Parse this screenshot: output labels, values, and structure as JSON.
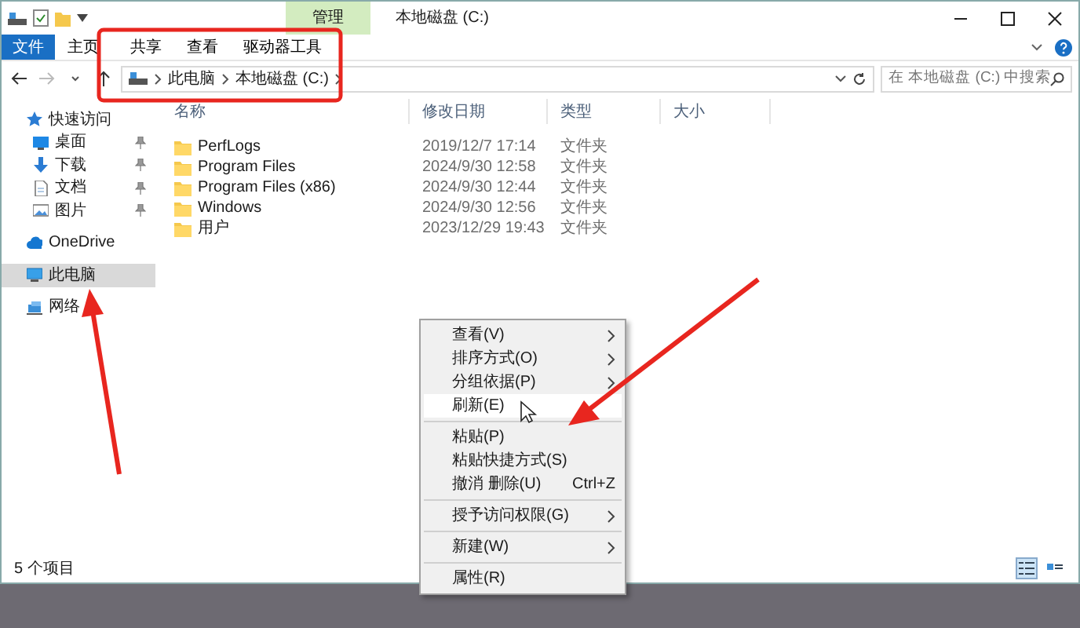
{
  "title_bar": {
    "context_tab": "管理",
    "title": "本地磁盘 (C:)"
  },
  "ribbon_tabs": [
    {
      "label": "文件",
      "kind": "file",
      "selected": false
    },
    {
      "label": "主页",
      "kind": "tab",
      "selected": false
    },
    {
      "label": "共享",
      "kind": "tab",
      "selected": false
    },
    {
      "label": "查看",
      "kind": "tab",
      "selected": false
    },
    {
      "label": "驱动器工具",
      "kind": "tab",
      "selected": false
    }
  ],
  "address_bar": {
    "path": [
      "此电脑",
      "本地磁盘 (C:)"
    ]
  },
  "search": {
    "placeholder": "在 本地磁盘 (C:) 中搜索"
  },
  "sidebar": {
    "items": [
      {
        "label": "快速访问",
        "kind": "star",
        "selected": false,
        "children": [
          {
            "label": "桌面",
            "kind": "desktop",
            "pinned": true,
            "selected": false
          },
          {
            "label": "下载",
            "kind": "download",
            "pinned": true,
            "selected": false
          },
          {
            "label": "文档",
            "kind": "document",
            "pinned": true,
            "selected": false
          },
          {
            "label": "图片",
            "kind": "picture",
            "pinned": true,
            "selected": false
          }
        ]
      },
      {
        "label": "OneDrive",
        "kind": "cloud",
        "selected": false
      },
      {
        "label": "此电脑",
        "kind": "computer",
        "selected": true
      },
      {
        "label": "网络",
        "kind": "network",
        "selected": false
      }
    ]
  },
  "table": {
    "columns": [
      "名称",
      "修改日期",
      "类型",
      "大小"
    ],
    "rows": [
      {
        "name": "PerfLogs",
        "modified": "2019/12/7 17:14",
        "type": "文件夹"
      },
      {
        "name": "Program Files",
        "modified": "2024/9/30 12:58",
        "type": "文件夹"
      },
      {
        "name": "Program Files (x86)",
        "modified": "2024/9/30 12:44",
        "type": "文件夹"
      },
      {
        "name": "Windows",
        "modified": "2024/9/30 12:56",
        "type": "文件夹"
      },
      {
        "name": "用户",
        "modified": "2023/12/29 19:43",
        "type": "文件夹"
      }
    ]
  },
  "context_menu": {
    "items": [
      {
        "kind": "item",
        "label": "查看(V)",
        "submenu": true,
        "selected": false
      },
      {
        "kind": "item",
        "label": "排序方式(O)",
        "submenu": true,
        "selected": false
      },
      {
        "kind": "item",
        "label": "分组依据(P)",
        "submenu": true,
        "selected": false
      },
      {
        "kind": "item",
        "label": "刷新(E)",
        "submenu": false,
        "selected": true
      },
      {
        "kind": "separator"
      },
      {
        "kind": "item",
        "label": "粘贴(P)",
        "submenu": false,
        "selected": false
      },
      {
        "kind": "item",
        "label": "粘贴快捷方式(S)",
        "submenu": false,
        "selected": false
      },
      {
        "kind": "item",
        "label": "撤消 删除(U)",
        "shortcut": "Ctrl+Z",
        "submenu": false,
        "selected": false
      },
      {
        "kind": "separator"
      },
      {
        "kind": "item",
        "label": "授予访问权限(G)",
        "submenu": true,
        "selected": false
      },
      {
        "kind": "separator"
      },
      {
        "kind": "item",
        "label": "新建(W)",
        "submenu": true,
        "selected": false
      },
      {
        "kind": "separator"
      },
      {
        "kind": "item",
        "label": "属性(R)",
        "submenu": false,
        "selected": false
      }
    ]
  },
  "status_bar": {
    "item_count": "5 个项目"
  },
  "view_buttons": [
    {
      "kind": "details",
      "selected": true
    },
    {
      "kind": "tiles",
      "selected": false
    }
  ]
}
